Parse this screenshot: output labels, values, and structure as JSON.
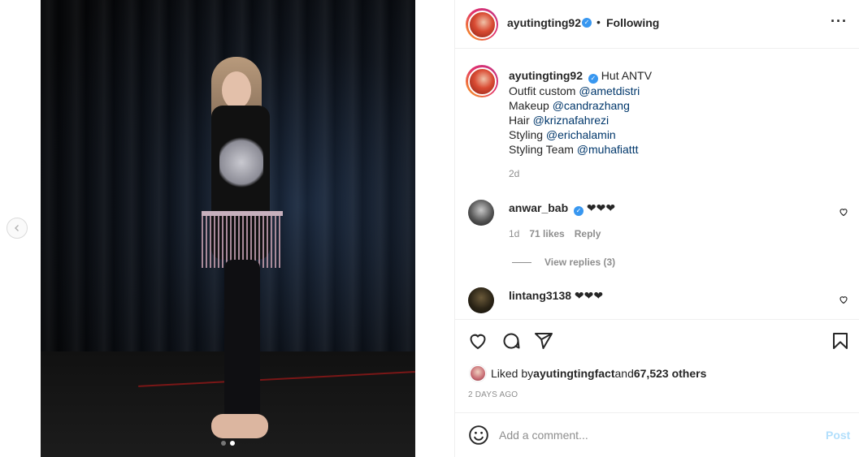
{
  "post": {
    "username": "ayutingting92",
    "follow_status": "Following",
    "bullet": "•",
    "more_icon": "···",
    "image_dots": 2,
    "active_dot": 1
  },
  "caption": {
    "username": "ayutingting92",
    "title": "Hut ANTV ",
    "lines": [
      {
        "prefix": "Outfit custom ",
        "mention": "@ametdistri"
      },
      {
        "prefix": "Makeup ",
        "mention": "@candrazhang"
      },
      {
        "prefix": "Hair ",
        "mention": "@kriznafahrezi"
      },
      {
        "prefix": "Styling ",
        "mention": "@erichalamin"
      },
      {
        "prefix": "Styling Team ",
        "mention": "@muhafiattt"
      }
    ],
    "time": "2d"
  },
  "comments": [
    {
      "username": "anwar_bab",
      "verified": true,
      "text": "❤❤❤",
      "time": "1d",
      "likes": "71 likes",
      "reply": "Reply",
      "view_replies": "View replies (3)"
    },
    {
      "username": "lintang3138",
      "verified": false,
      "text": "❤❤❤"
    }
  ],
  "likes": {
    "prefix": "Liked by ",
    "user": "ayutingtingfact",
    "middle": " and ",
    "count": "67,523 others"
  },
  "posted_ago": "2 DAYS AGO",
  "add_comment": {
    "placeholder": "Add a comment...",
    "post_label": "Post"
  },
  "colors": {
    "verified": "#3897f0",
    "mention": "#00376b",
    "secondary_text": "#8e8e8e",
    "post_disabled": "#b2dffc"
  },
  "icons": {
    "heart": "heart-icon",
    "comment": "comment-icon",
    "share": "paper-plane-icon",
    "save": "bookmark-icon",
    "emoji": "smiley-icon",
    "prev": "chevron-left-icon"
  }
}
